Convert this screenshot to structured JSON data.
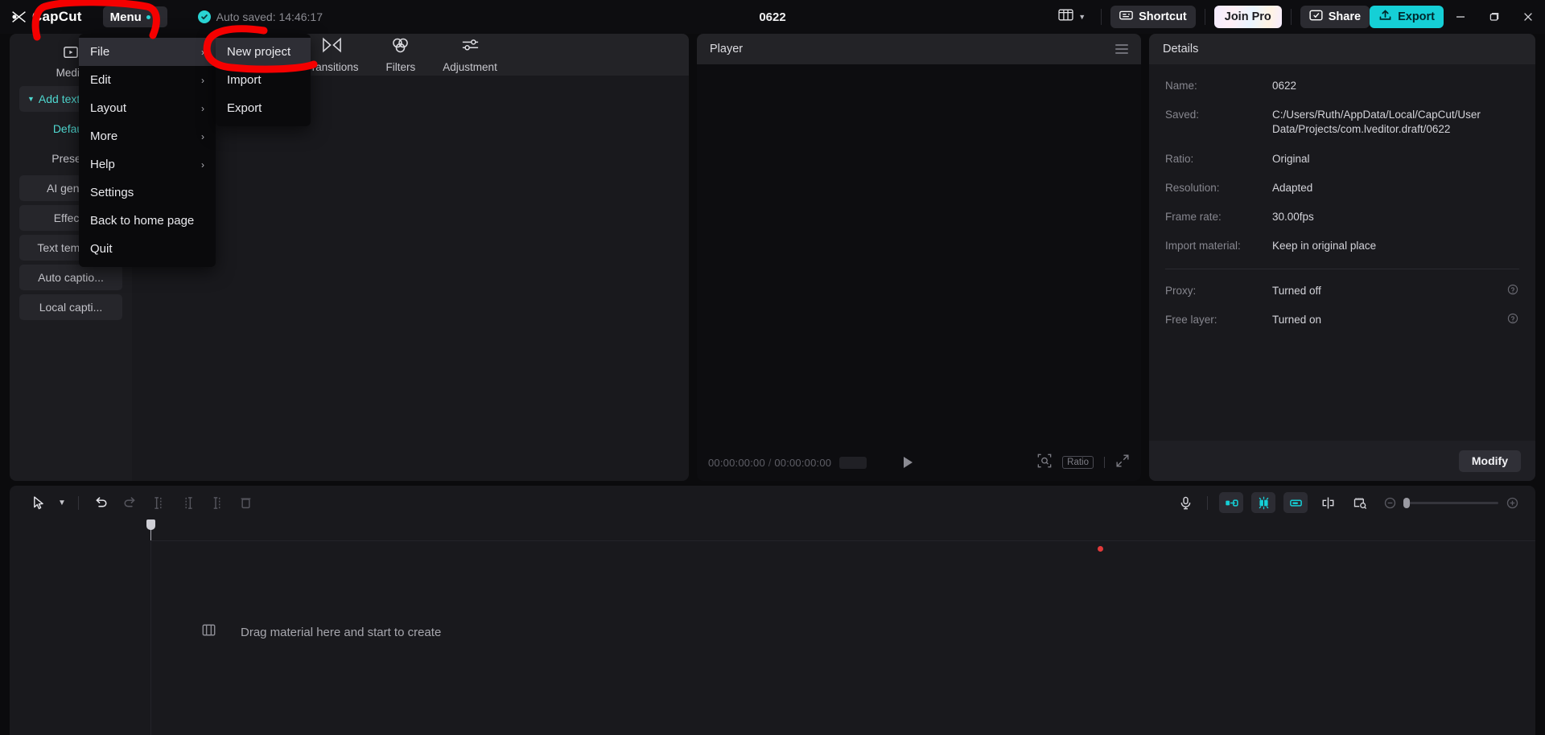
{
  "titlebar": {
    "brand": "CapCut",
    "menu_label": "Menu",
    "autosave": "Auto saved: 14:46:17",
    "project_title": "0622",
    "shortcut": "Shortcut",
    "join_pro": "Join Pro",
    "share": "Share",
    "export": "Export"
  },
  "menu": {
    "items": [
      {
        "label": "File",
        "submenu": true,
        "highlighted": true
      },
      {
        "label": "Edit",
        "submenu": true,
        "highlighted": false
      },
      {
        "label": "Layout",
        "submenu": true,
        "highlighted": false
      },
      {
        "label": "More",
        "submenu": true,
        "highlighted": false
      },
      {
        "label": "Help",
        "submenu": true,
        "highlighted": false
      },
      {
        "label": "Settings",
        "submenu": false,
        "highlighted": false
      },
      {
        "label": "Back to home page",
        "submenu": false,
        "highlighted": false
      },
      {
        "label": "Quit",
        "submenu": false,
        "highlighted": false
      }
    ],
    "submenu": {
      "items": [
        {
          "label": "New project",
          "highlighted": true
        },
        {
          "label": "Import",
          "highlighted": false
        },
        {
          "label": "Export",
          "highlighted": false
        }
      ]
    }
  },
  "nav_rail": {
    "tab_label": "Media",
    "items": [
      {
        "label": "Add text",
        "accent": true,
        "caret": true
      },
      {
        "label": "Default",
        "accent": true,
        "plain": true
      },
      {
        "label": "Presets",
        "accent": false,
        "plain": true
      },
      {
        "label": "AI gene...",
        "accent": false,
        "plain": false
      },
      {
        "label": "Effects",
        "accent": false,
        "plain": false
      },
      {
        "label": "Text template",
        "accent": false,
        "plain": false
      },
      {
        "label": "Auto captio...",
        "accent": false,
        "plain": false
      },
      {
        "label": "Local capti...",
        "accent": false,
        "plain": false
      }
    ]
  },
  "library": {
    "tabs": [
      {
        "label": "Transitions",
        "icon": "transitions-icon"
      },
      {
        "label": "Filters",
        "icon": "filters-icon"
      },
      {
        "label": "Adjustment",
        "icon": "adjustment-icon"
      }
    ]
  },
  "player": {
    "title": "Player",
    "current_time": "00:00:00:00",
    "total_time": "00:00:00:00",
    "time_separator": "/",
    "ratio_label": "Ratio"
  },
  "details": {
    "title": "Details",
    "rows": [
      {
        "label": "Name:",
        "value": "0622",
        "help": false
      },
      {
        "label": "Saved:",
        "value": "C:/Users/Ruth/AppData/Local/CapCut/User Data/Projects/com.lveditor.draft/0622",
        "help": false
      },
      {
        "label": "Ratio:",
        "value": "Original",
        "help": false
      },
      {
        "label": "Resolution:",
        "value": "Adapted",
        "help": false
      },
      {
        "label": "Frame rate:",
        "value": "30.00fps",
        "help": false
      },
      {
        "label": "Import material:",
        "value": "Keep in original place",
        "help": false
      }
    ],
    "rows2": [
      {
        "label": "Proxy:",
        "value": "Turned off",
        "help": true
      },
      {
        "label": "Free layer:",
        "value": "Turned on",
        "help": true
      }
    ],
    "modify_label": "Modify"
  },
  "timeline": {
    "dropzone_text": "Drag material here and start to create"
  }
}
